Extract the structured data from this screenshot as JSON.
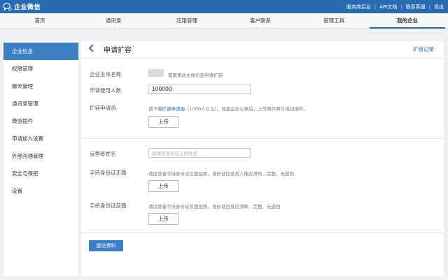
{
  "topbar": {
    "brand": "企业微信",
    "links": [
      "服务商后台",
      "API文档",
      "联系客服",
      "退出"
    ]
  },
  "nav": {
    "items": [
      "首页",
      "通讯录",
      "应用管理",
      "客户联系",
      "管理工具",
      "我的企业"
    ],
    "active_index": 5
  },
  "sidebar": {
    "items": [
      "企业信息",
      "权限管理",
      "聊天管理",
      "通讯录管理",
      "微信插件",
      "申请加入设置",
      "外部沟通管理",
      "安全与保密",
      "设置"
    ],
    "active_index": 0
  },
  "page": {
    "title": "申请扩容",
    "history_link": "扩容记录"
  },
  "form": {
    "entity_label": "企业主体名称",
    "entity_hint": "需要用此主体信息申请扩容",
    "count_label": "申请使用人数",
    "count_value": "100000",
    "letter_label": "扩容申请函",
    "letter_hint_prefix": "请下载",
    "letter_hint_link": "扩容申请函",
    "letter_hint_suffix": "（1000人以上），加盖企业公章后，上传原件照片或扫描件。",
    "upload_label": "上传",
    "operator_label": "运营者姓名",
    "operator_placeholder": "请填写身份证上的姓名",
    "id_front_label": "手持身份证正面",
    "id_front_hint": "请运营者手持身份证正面拍照，身份证信息及人像应清晰、完整、无遮挡",
    "id_back_label": "手持身份证反面",
    "id_back_hint": "请运营者手持身份证反面拍照，身份证信息应清晰、完整、无遮挡",
    "submit_label": "提交资料"
  },
  "colors": {
    "brand": "#2a6ab0",
    "accent": "#3e7fc4"
  }
}
